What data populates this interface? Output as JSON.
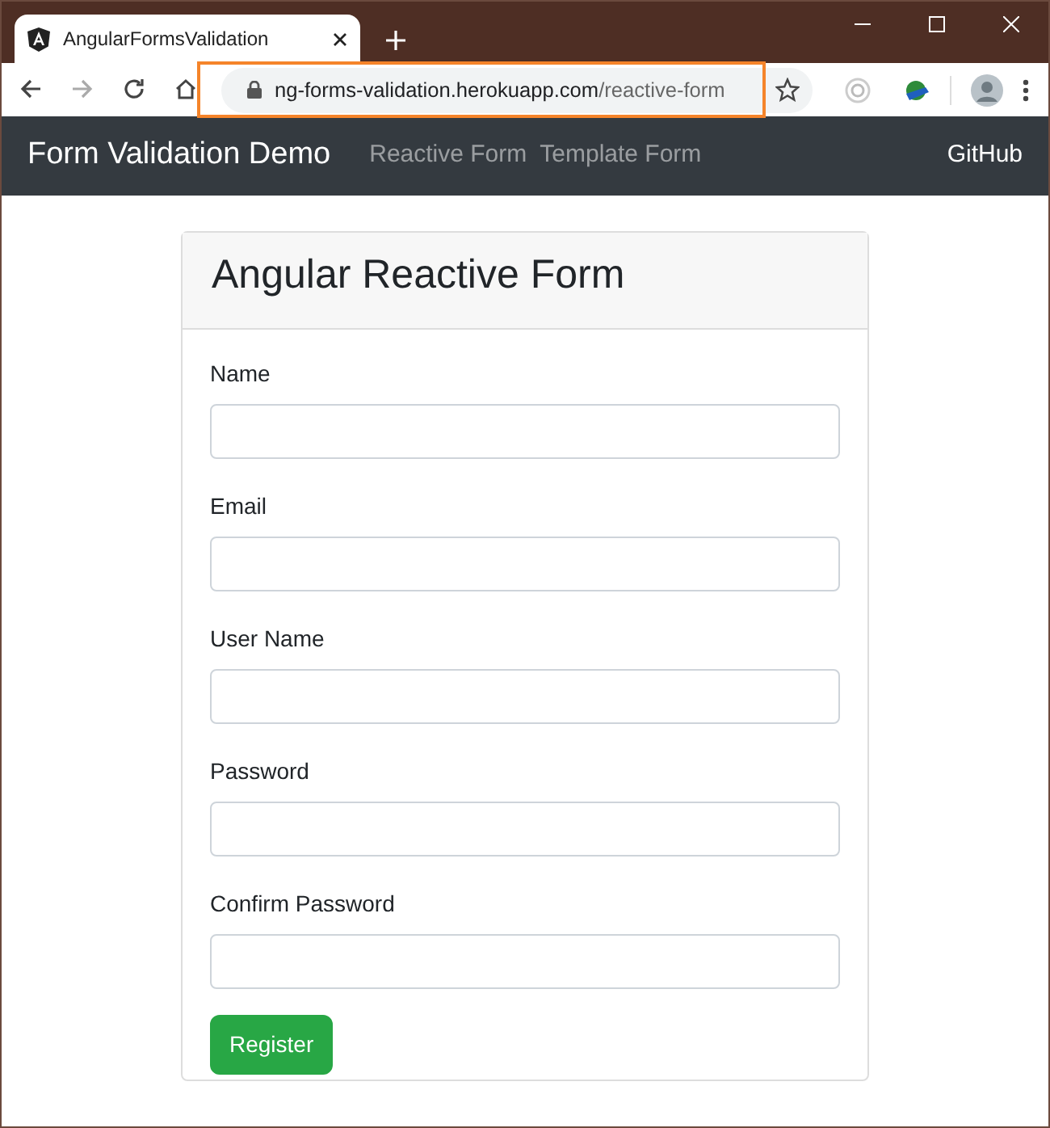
{
  "browser": {
    "tab_title": "AngularFormsValidation",
    "url_host": "ng-forms-validation.herokuapp.com",
    "url_path": "/reactive-form"
  },
  "navbar": {
    "brand": "Form Validation Demo",
    "links": [
      {
        "label": "Reactive Form",
        "selected": false
      },
      {
        "label": "Template Form",
        "selected": false
      }
    ],
    "right_link": "GitHub"
  },
  "form": {
    "title": "Angular Reactive Form",
    "fields": [
      {
        "label": "Name"
      },
      {
        "label": "Email"
      },
      {
        "label": "User Name"
      },
      {
        "label": "Password"
      },
      {
        "label": "Confirm Password"
      }
    ],
    "submit": "Register"
  }
}
